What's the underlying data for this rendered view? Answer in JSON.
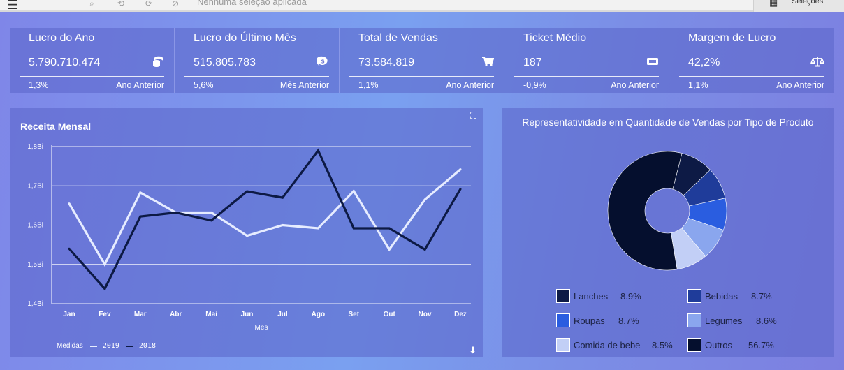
{
  "toolbar": {
    "no_selection": "Nenhuma seleção aplicada",
    "selections_label": "Seleções"
  },
  "kpis": [
    {
      "title": "Lucro do Ano",
      "value": "5.790.710.474",
      "icon": "coins-icon",
      "pct": "1,3%",
      "ref": "Ano Anterior"
    },
    {
      "title": "Lucro do Último Mês",
      "value": "515.805.783",
      "icon": "dollar-icon",
      "pct": "5,6%",
      "ref": "Mês Anterior"
    },
    {
      "title": "Total de Vendas",
      "value": "73.584.819",
      "icon": "cart-icon",
      "pct": "1,1%",
      "ref": "Ano Anterior"
    },
    {
      "title": "Ticket Médio",
      "value": "187",
      "icon": "ticket-icon",
      "pct": "-0,9%",
      "ref": "Ano Anterior"
    },
    {
      "title": "Margem de Lucro",
      "value": "42,2%",
      "icon": "balance-icon",
      "pct": "1,1%",
      "ref": "Ano Anterior"
    }
  ],
  "line_panel": {
    "title": "Receita Mensal",
    "legend_label": "Medidas"
  },
  "pie_panel": {
    "title": "Representatividade em Quantidade de Vendas por Tipo de Produto"
  },
  "chart_data": [
    {
      "type": "line",
      "title": "Receita Mensal",
      "xlabel": "Mes",
      "ylabel": "",
      "categories": [
        "Jan",
        "Fev",
        "Mar",
        "Abr",
        "Mai",
        "Jun",
        "Jul",
        "Ago",
        "Set",
        "Out",
        "Nov",
        "Dez"
      ],
      "ylim": [
        1.4,
        1.8
      ],
      "yticks": [
        "1,4Bi",
        "1,5Bi",
        "1,6Bi",
        "1,7Bi",
        "1,8Bi"
      ],
      "grid": true,
      "legend_position": "bottom-left",
      "series": [
        {
          "name": "2019",
          "color": "#e6ecff",
          "values": [
            1.655,
            1.5,
            1.683,
            1.632,
            1.632,
            1.573,
            1.6,
            1.592,
            1.687,
            1.538,
            1.665,
            1.742
          ]
        },
        {
          "name": "2018",
          "color": "#0d1a45",
          "values": [
            1.54,
            1.438,
            1.622,
            1.632,
            1.612,
            1.686,
            1.67,
            1.79,
            1.592,
            1.592,
            1.538,
            1.692
          ]
        }
      ]
    },
    {
      "type": "pie",
      "title": "Representatividade em Quantidade de Vendas por Tipo de Produto",
      "legend_position": "bottom",
      "slices": [
        {
          "label": "Lanches",
          "value": 8.9,
          "display": "8.9%",
          "color": "#0d1a45"
        },
        {
          "label": "Bebidas",
          "value": 8.7,
          "display": "8.7%",
          "color": "#1f3c9a"
        },
        {
          "label": "Roupas",
          "value": 8.7,
          "display": "8.7%",
          "color": "#2a5de0"
        },
        {
          "label": "Legumes",
          "value": 8.6,
          "display": "8.6%",
          "color": "#8aa6ee"
        },
        {
          "label": "Comida de bebe",
          "value": 8.5,
          "display": "8.5%",
          "color": "#c2cff6"
        },
        {
          "label": "Outros",
          "value": 56.7,
          "display": "56.7%",
          "color": "#050f2e"
        }
      ]
    }
  ]
}
